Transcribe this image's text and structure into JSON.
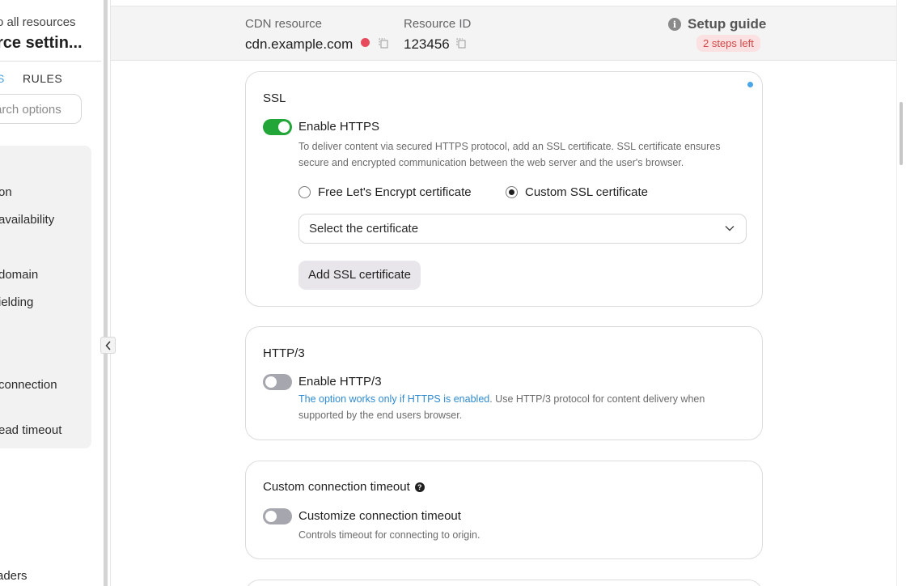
{
  "sidebar": {
    "back_link": "o all resources",
    "title": "rce settin...",
    "tabs": [
      {
        "label": "S"
      },
      {
        "label": "RULES"
      }
    ],
    "search_placeholder": "arch options",
    "items": [
      {
        "label": "on"
      },
      {
        "label": "availability"
      },
      {
        "label": "domain"
      },
      {
        "label": "ielding"
      },
      {
        "label": "connection"
      },
      {
        "label": "ead timeout"
      }
    ],
    "bottom_item": "aders"
  },
  "header": {
    "cdn_label": "CDN resource",
    "cdn_value": "cdn.example.com",
    "status_color": "#e64a5c",
    "id_label": "Resource ID",
    "id_value": "123456",
    "setup_guide": "Setup guide",
    "steps_badge": "2 steps left"
  },
  "cards": {
    "ssl": {
      "title": "SSL",
      "toggle_label": "Enable HTTPS",
      "toggle_state": "on",
      "description": "To deliver content via secured HTTPS protocol, add an SSL certificate. SSL certificate ensures secure and encrypted communication between the web server and the user's browser.",
      "radio_free": "Free Let's Encrypt certificate",
      "radio_custom": "Custom SSL certificate",
      "selected_radio": "custom",
      "select_value": "Select the certificate",
      "add_button": "Add SSL certificate"
    },
    "http3": {
      "title": "HTTP/3",
      "toggle_label": "Enable HTTP/3",
      "toggle_state": "off",
      "description_link": "The option works only if HTTPS is enabled",
      "description_rest": ". Use HTTP/3 protocol for content delivery when supported by the end users browser."
    },
    "timeout": {
      "title": "Custom connection timeout",
      "toggle_label": "Customize connection timeout",
      "toggle_state": "off",
      "description": "Controls timeout for connecting to origin."
    }
  },
  "colors": {
    "toggle_on": "#22a638",
    "toggle_off": "#a6a6ae",
    "accent_blue": "#4aa6e8",
    "link": "#2f8ad0"
  }
}
